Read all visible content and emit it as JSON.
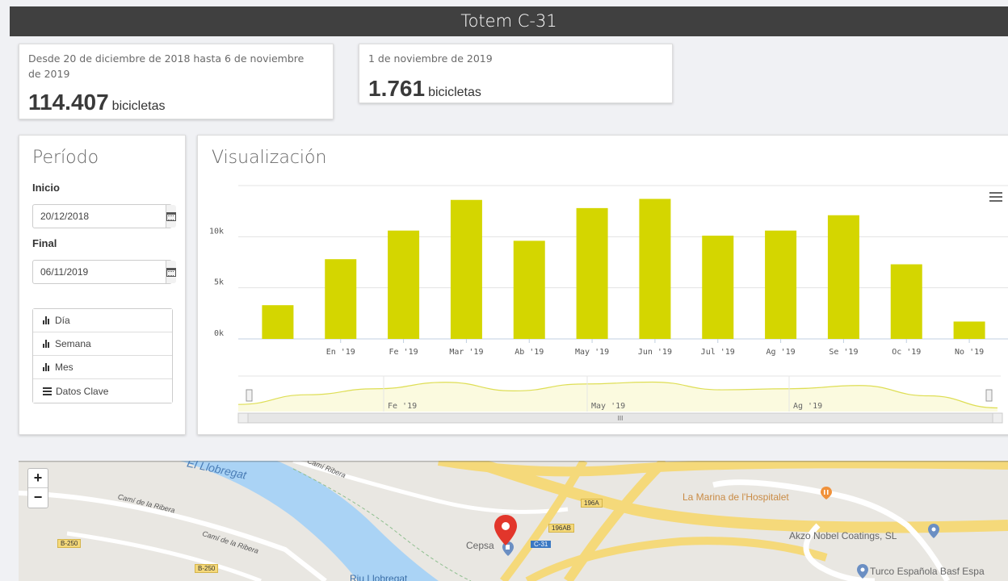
{
  "header": {
    "title": "Totem C-31"
  },
  "stats": [
    {
      "label": "Desde 20 de diciembre de 2018 hasta 6 de noviembre de 2019",
      "value": "114.407",
      "unit": "bicicletas"
    },
    {
      "label": "1 de noviembre de 2019",
      "value": "1.761",
      "unit": "bicicletas"
    }
  ],
  "period": {
    "title": "Período",
    "start_label": "Inicio",
    "start_value": "20/12/2018",
    "end_label": "Final",
    "end_value": "06/11/2019",
    "buttons": [
      {
        "label": "Día",
        "icon": "bar-chart-icon"
      },
      {
        "label": "Semana",
        "icon": "bar-chart-icon"
      },
      {
        "label": "Mes",
        "icon": "bar-chart-icon"
      },
      {
        "label": "Datos Clave",
        "icon": "list-icon"
      }
    ]
  },
  "visualization": {
    "title": "Visualización",
    "menu_icon": "hamburger-icon"
  },
  "chart_data": {
    "type": "bar",
    "categories": [
      "",
      "En '19",
      "Fe '19",
      "Mar '19",
      "Ab '19",
      "May '19",
      "Jun '19",
      "Jul '19",
      "Ag '19",
      "Se '19",
      "Oc '19",
      "No '19"
    ],
    "values": [
      3300,
      7800,
      10600,
      13600,
      9600,
      12800,
      13700,
      10100,
      10600,
      12100,
      7300,
      1700
    ],
    "y_ticks": [
      "0k",
      "5k",
      "10k"
    ],
    "ylim": [
      0,
      15000
    ],
    "color": "#d4d600",
    "grid": true,
    "navigator_labels": [
      "Fe '19",
      "May '19",
      "Ag '19"
    ],
    "navigator_scroll_label": "III"
  },
  "map": {
    "zoom_in": "+",
    "zoom_out": "−",
    "labels": {
      "river": "El Llobregat",
      "cami_ribera": "Camí Ribera",
      "cami_de_la_ribera_1": "Camí de la Ribera",
      "cami_de_la_ribera_2": "Camí de la Ribera",
      "b250_1": "B-250",
      "b250_2": "B-250",
      "exit_196a": "196A",
      "exit_196ab": "196AB",
      "c31": "C-31",
      "cepsa": "Cepsa",
      "marina": "La Marina de l'Hospitalet",
      "akzo": "Akzo Nobel Coatings, SL",
      "turco": "Turco Española Basf Espa",
      "riu": "Riu Llobregat"
    }
  }
}
